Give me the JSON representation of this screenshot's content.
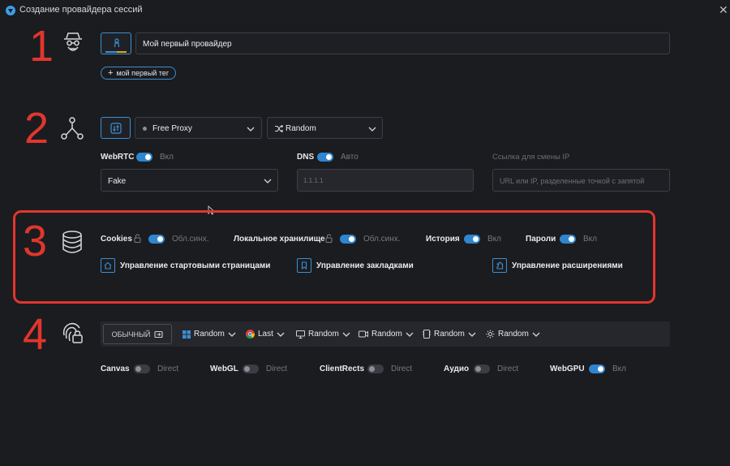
{
  "window": {
    "title": "Создание провайдера сессий"
  },
  "steps": [
    "1",
    "2",
    "3",
    "4"
  ],
  "section1": {
    "name_value": "Мой первый провайдер",
    "tag_label": "мой первый тег"
  },
  "section2": {
    "proxy_select": "Free Proxy",
    "rotation_select": "Random",
    "webrtc": {
      "label": "WebRTC",
      "state": "Вкл",
      "value": "Fake"
    },
    "dns": {
      "label": "DNS",
      "state": "Авто",
      "placeholder": "1.1.1.1"
    },
    "ip_change": {
      "label": "Ссылка для смены IP",
      "placeholder": "URL или IP, разделенные точкой с запятой"
    }
  },
  "section3": {
    "cookies": {
      "label": "Cookies",
      "state": "Обл.синх."
    },
    "local_storage": {
      "label": "Локальное хранилище",
      "state": "Обл.синх."
    },
    "history": {
      "label": "История",
      "state": "Вкл"
    },
    "passwords": {
      "label": "Пароли",
      "state": "Вкл"
    },
    "links": [
      "Управление стартовыми страницами",
      "Управление закладками",
      "Управление расширениями"
    ]
  },
  "section4": {
    "mode_button": "ОБЫЧНЫЙ",
    "os": "Random",
    "browser": "Last",
    "screen": "Random",
    "webcam": "Random",
    "cpu": "Random",
    "gpu": "Random",
    "toggles": [
      {
        "label": "Canvas",
        "state": "Direct"
      },
      {
        "label": "WebGL",
        "state": "Direct"
      },
      {
        "label": "ClientRects",
        "state": "Direct"
      },
      {
        "label": "Аудио",
        "state": "Direct"
      },
      {
        "label": "WebGPU",
        "state": "Вкл"
      }
    ]
  },
  "colors": {
    "accent": "#2f86d0",
    "highlight": "#e1362d",
    "background": "#1b1c20"
  }
}
